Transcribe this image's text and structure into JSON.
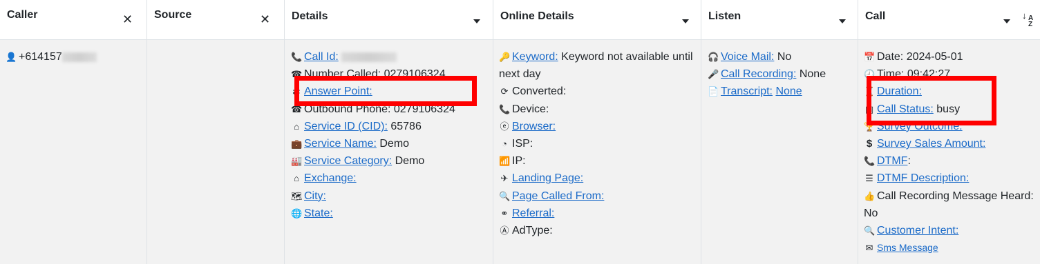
{
  "columns": [
    {
      "label": "Caller",
      "control": "close"
    },
    {
      "label": "Source",
      "control": "close"
    },
    {
      "label": "Details",
      "control": "dropdown"
    },
    {
      "label": "Online Details",
      "control": "dropdown"
    },
    {
      "label": "Listen",
      "control": "dropdown"
    },
    {
      "label": "Call",
      "control": "dropdown",
      "sort": "A Z"
    }
  ],
  "caller": {
    "phone": "+614157"
  },
  "details": {
    "call_id_label": "Call Id:",
    "number_called_text": "Number Called: 0279106324",
    "answer_point_label": "Answer Point:",
    "outbound_phone_text": "Outbound Phone: 0279106324",
    "service_id_label": "Service ID (CID):",
    "service_id_value": "65786",
    "service_name_label": "Service Name:",
    "service_name_value": "Demo",
    "service_category_label": "Service Category:",
    "service_category_value": "Demo",
    "exchange_label": "Exchange:",
    "city_label": "City:",
    "state_label": "State:"
  },
  "online": {
    "keyword_label": "Keyword:",
    "keyword_value": "Keyword not available until next day",
    "converted_text": "Converted:",
    "device_text": "Device:",
    "browser_label": "Browser:",
    "isp_text": "ISP:",
    "ip_text": "IP:",
    "landing_page_label": "Landing Page:",
    "page_called_from_label": "Page Called From:",
    "referral_label": "Referral:",
    "adtype_text": "AdType:"
  },
  "listen": {
    "voice_mail_label": "Voice Mail:",
    "voice_mail_value": "No",
    "call_recording_label": "Call Recording:",
    "call_recording_value": "None",
    "transcript_label": "Transcript:",
    "transcript_value": "None"
  },
  "call": {
    "date_text": "Date: 2024-05-01",
    "time_text": "Time: 09:42:27",
    "duration_label": "Duration:",
    "call_status_label": "Call Status:",
    "call_status_value": "busy",
    "survey_outcome_label": "Survey Outcome:",
    "survey_sales_label": "Survey Sales Amount:",
    "dtmf_label": "DTMF",
    "dtmf_suffix": ":",
    "dtmf_description_label": "DTMF Description:",
    "crm_text": "Call Recording Message Heard: No",
    "customer_intent_label": "Customer Intent:",
    "sms_label": "Sms Message"
  },
  "colors": {
    "link": "#1a6ac8",
    "highlight": "#ff0000",
    "row_bg": "#f2f2f2"
  }
}
